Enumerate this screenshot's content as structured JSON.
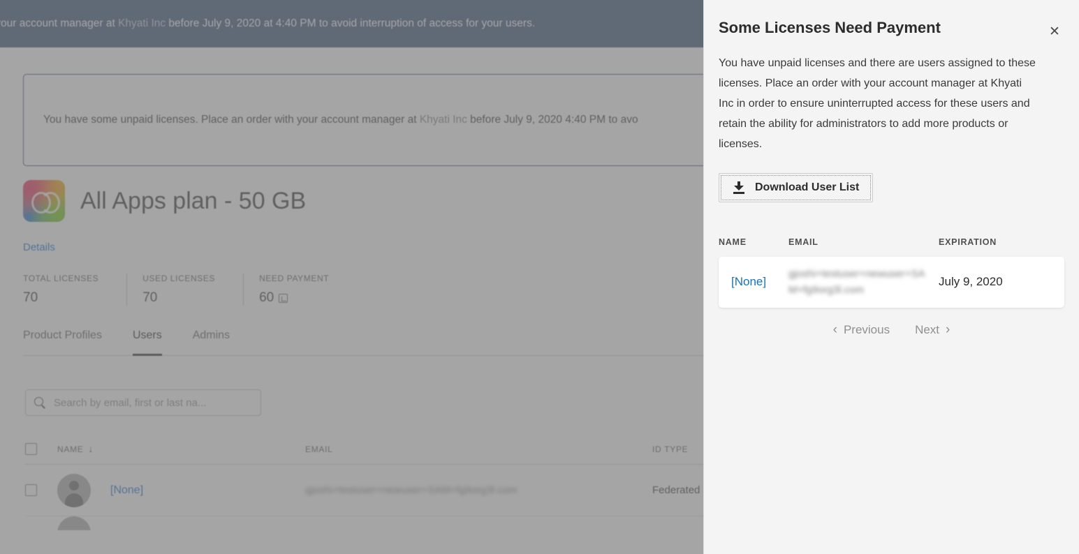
{
  "background": {
    "top_banner": {
      "text_before_org": "n order with your account manager at ",
      "org": "Khyati Inc",
      "text_after_org": " before July 9, 2020 at 4:40 PM to avoid interruption of access for your users.",
      "bg_color": "#4a6183"
    },
    "alert": {
      "text_before_org": "You have some unpaid licenses. Place an order with your account manager at ",
      "org": "Khyati Inc",
      "text_after_org": " before July 9, 2020 4:40 PM to avo",
      "border_color": "#4a6183"
    },
    "plan": {
      "icon": "creative-cloud-icon",
      "title": "All Apps plan - 50 GB",
      "details_link": "Details",
      "link_color": "#2680d2"
    },
    "stats": [
      {
        "label": "TOTAL LICENSES",
        "value": "70",
        "has_icon": false
      },
      {
        "label": "USED LICENSES",
        "value": "70",
        "has_icon": false
      },
      {
        "label": "NEED PAYMENT",
        "value": "60",
        "has_icon": true
      }
    ],
    "tabs": [
      {
        "label": "Product Profiles",
        "active": false
      },
      {
        "label": "Users",
        "active": true
      },
      {
        "label": "Admins",
        "active": false
      }
    ],
    "search": {
      "placeholder": "Search by email, first or last na...",
      "value": "",
      "icon": "search-icon"
    },
    "user_table": {
      "columns": [
        "NAME",
        "EMAIL",
        "ID TYPE"
      ],
      "sort_indicator": "↓",
      "rows": [
        {
          "name": "[None]",
          "email": "gjoshi+testuser+newuser+SAM+fg9org3l.com",
          "id_type": "Federated ID"
        }
      ]
    }
  },
  "panel": {
    "title": "Some Licenses Need Payment",
    "close_label": "✕",
    "body": "You have unpaid licenses and there are users assigned to these licenses. Place an order with your account manager at Khyati Inc in order to ensure uninterrupted access for these users and retain the ability for administrators to add more products or licenses.",
    "download_button": {
      "label": "Download User List",
      "icon": "download-icon"
    },
    "table": {
      "columns": [
        "NAME",
        "EMAIL",
        "EXPIRATION"
      ],
      "rows": [
        {
          "name": "[None]",
          "email": "gjoshi+testuser+newuser+SAM+fg9org3l.com",
          "expiration": "July 9, 2020"
        }
      ]
    },
    "pagination": {
      "previous": "Previous",
      "next": "Next",
      "prev_chevron": "‹",
      "next_chevron": "›"
    },
    "background_color": "#f4f4f4",
    "link_color": "#1473c4"
  }
}
